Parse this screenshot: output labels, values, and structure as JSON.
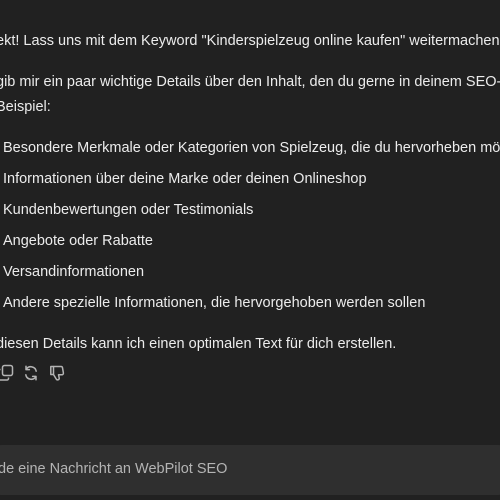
{
  "message": {
    "intro_line_1": "ekt! Lass uns mit dem Keyword \"Kinderspielzeug online kaufen\" weitermachen.",
    "intro_line_2": "gib mir ein paar wichtige Details über den Inhalt, den du gerne in deinem SEO-Tex",
    "intro_line_3": "Beispiel:",
    "items": [
      "Besondere Merkmale oder Kategorien von Spielzeug, die du hervorheben möchtes",
      "Informationen über deine Marke oder deinen Onlineshop",
      "Kundenbewertungen oder Testimonials",
      "Angebote oder Rabatte",
      "Versandinformationen",
      "Andere spezielle Informationen, die hervorgehoben werden sollen"
    ],
    "outro": "diesen Details kann ich einen optimalen Text für dich erstellen."
  },
  "actions": [
    {
      "icon": "copy-icon"
    },
    {
      "icon": "regenerate-icon"
    },
    {
      "icon": "thumbs-down-icon"
    }
  ],
  "composer": {
    "placeholder": "de eine Nachricht an WebPilot SEO"
  },
  "colors": {
    "background": "#212121",
    "text": "#ececec",
    "composer_bg": "#2f2f2f",
    "icon": "#b4b4b4"
  }
}
